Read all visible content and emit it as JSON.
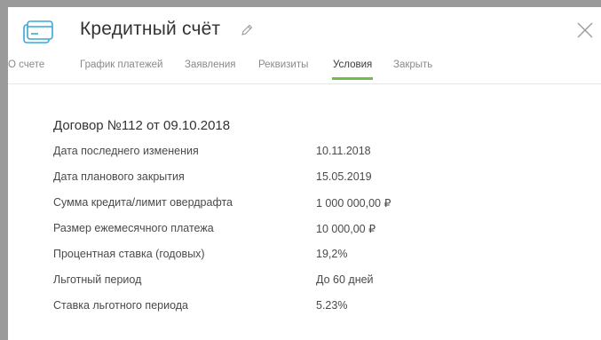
{
  "header": {
    "title": "Кредитный счёт",
    "icon": "credit-card-icon",
    "edit_icon": "pencil-icon",
    "close_icon": "close-icon"
  },
  "tabs": [
    {
      "label": "О счете"
    },
    {
      "label": "График платежей"
    },
    {
      "label": "Заявления"
    },
    {
      "label": "Реквизиты"
    },
    {
      "label": "Условия",
      "active": true
    },
    {
      "label": "Закрыть"
    }
  ],
  "accent_color": "#6cc04a",
  "icon_color": "#39a9d8",
  "contract": {
    "heading": "Договор №112 от 09.10.2018",
    "rows": [
      {
        "label": "Дата последнего изменения",
        "value": "10.11.2018"
      },
      {
        "label": "Дата планового закрытия",
        "value": "15.05.2019"
      },
      {
        "label": "Сумма кредита/лимит овердрафта",
        "value": "1 000 000,00 ₽"
      },
      {
        "label": "Размер ежемесячного платежа",
        "value": "10 000,00 ₽"
      },
      {
        "label": "Процентная ставка (годовых)",
        "value": "19,2%"
      },
      {
        "label": "Льготный период",
        "value": "До 60 дней"
      },
      {
        "label": "Ставка льготного периода",
        "value": "5.23%"
      }
    ]
  }
}
